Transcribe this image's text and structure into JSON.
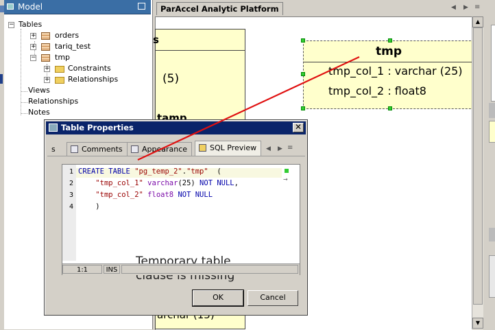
{
  "model_panel": {
    "title": "Model",
    "tree": [
      {
        "label": "Tables"
      },
      {
        "label": "orders"
      },
      {
        "label": "tariq_test"
      },
      {
        "label": "tmp"
      },
      {
        "label": "Constraints"
      },
      {
        "label": "Relationships"
      },
      {
        "label": "Views"
      },
      {
        "label": "Relationships"
      },
      {
        "label": "Notes"
      }
    ]
  },
  "editor": {
    "tab_title": "ParAccel Analytic Platform",
    "left_entity": {
      "header": "s",
      "value1": "(5)",
      "value2": "tamp",
      "value3": "archar (15)"
    },
    "tmp_entity": {
      "name": "tmp",
      "columns": [
        "tmp_col_1 : varchar (25)",
        "tmp_col_2 : float8"
      ]
    }
  },
  "dialog": {
    "title": "Table Properties",
    "close_glyph": "✕",
    "tab_fragment": "s",
    "tabs": [
      {
        "label": "Comments"
      },
      {
        "label": "Appearance"
      },
      {
        "label": "SQL Preview"
      }
    ],
    "sql": {
      "line_numbers": [
        "1",
        "2",
        "3",
        "4"
      ],
      "status_position": "1:1",
      "status_mode": "INS"
    },
    "annotation": [
      "Temporary table",
      "clause is missing"
    ],
    "ok_label": "OK",
    "cancel_label": "Cancel"
  },
  "colors": {
    "annotation_line": "#e01010",
    "selection_handle": "#33cc33",
    "title_bar": "#0a246a"
  }
}
